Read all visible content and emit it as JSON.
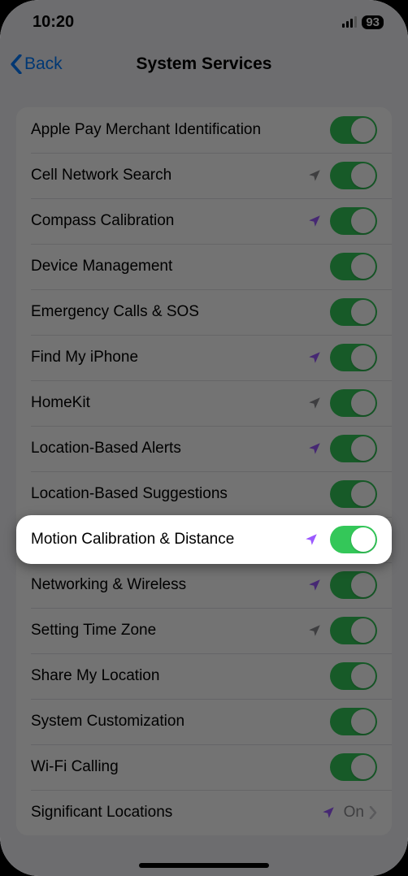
{
  "status": {
    "time": "10:20",
    "battery": "93"
  },
  "nav": {
    "back": "Back",
    "title": "System Services"
  },
  "colors": {
    "accent": "#007aff",
    "toggleOn": "#34c759",
    "arrowPurple": "#9b59ff",
    "arrowGray": "#8a8a8e"
  },
  "highlightIndex": 9,
  "items": [
    {
      "label": "Apple Pay Merchant Identification",
      "arrow": null,
      "toggle": true
    },
    {
      "label": "Cell Network Search",
      "arrow": "gray",
      "toggle": true
    },
    {
      "label": "Compass Calibration",
      "arrow": "purple",
      "toggle": true
    },
    {
      "label": "Device Management",
      "arrow": null,
      "toggle": true
    },
    {
      "label": "Emergency Calls & SOS",
      "arrow": null,
      "toggle": true
    },
    {
      "label": "Find My iPhone",
      "arrow": "purple",
      "toggle": true
    },
    {
      "label": "HomeKit",
      "arrow": "gray",
      "toggle": true
    },
    {
      "label": "Location-Based Alerts",
      "arrow": "purple",
      "toggle": true
    },
    {
      "label": "Location-Based Suggestions",
      "arrow": null,
      "toggle": true
    },
    {
      "label": "Motion Calibration & Distance",
      "arrow": "purple",
      "toggle": true
    },
    {
      "label": "Networking & Wireless",
      "arrow": "purple",
      "toggle": true
    },
    {
      "label": "Setting Time Zone",
      "arrow": "gray",
      "toggle": true
    },
    {
      "label": "Share My Location",
      "arrow": null,
      "toggle": true
    },
    {
      "label": "System Customization",
      "arrow": null,
      "toggle": true
    },
    {
      "label": "Wi-Fi Calling",
      "arrow": null,
      "toggle": true
    },
    {
      "label": "Significant Locations",
      "arrow": "purple",
      "link": true,
      "value": "On"
    }
  ]
}
